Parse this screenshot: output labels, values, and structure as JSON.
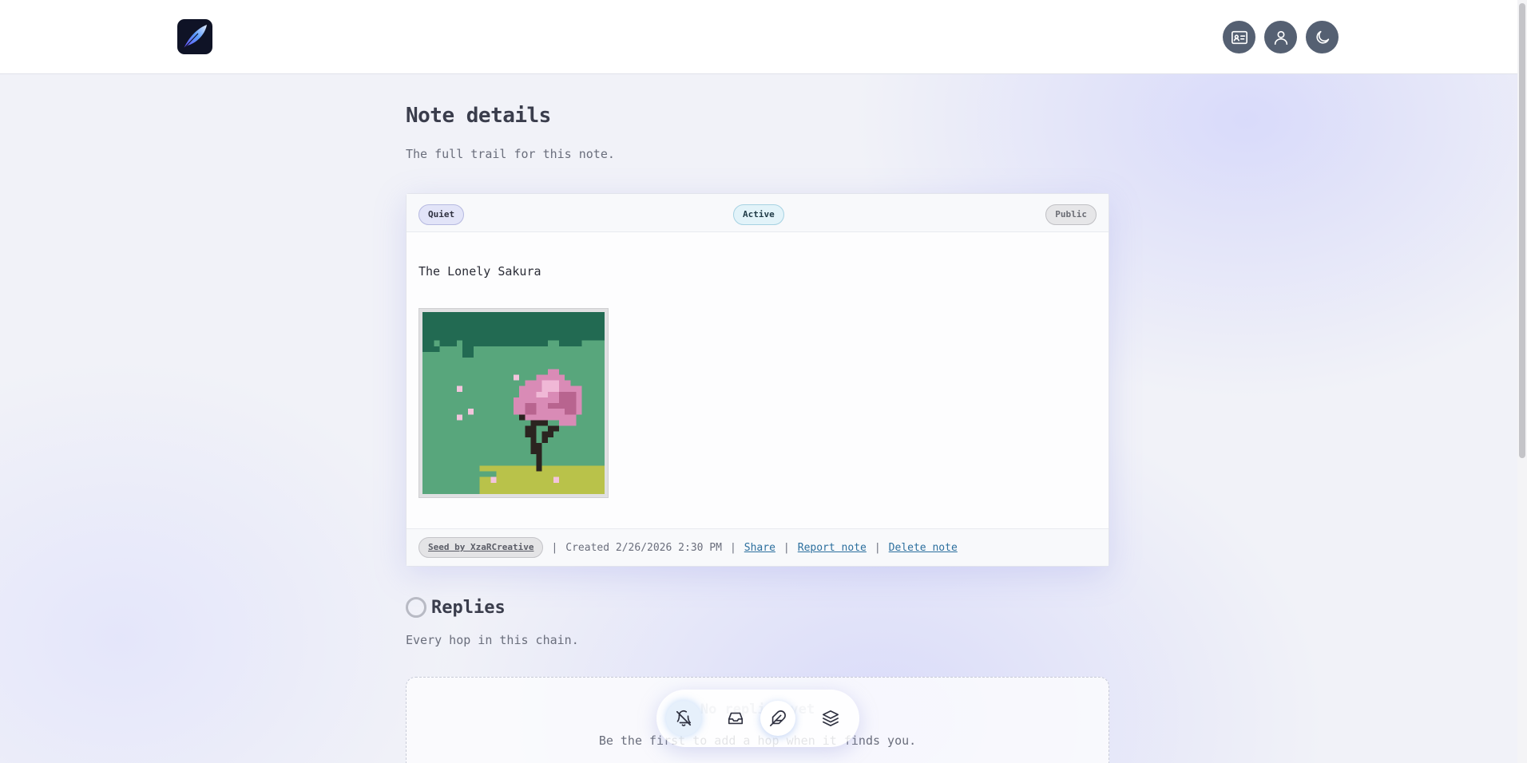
{
  "header": {
    "logo": "feather-logo",
    "icons": [
      "id-card-icon",
      "user-icon",
      "moon-icon"
    ]
  },
  "page": {
    "title": "Note details",
    "subtitle": "The full trail for this note."
  },
  "note": {
    "badges": {
      "quiet": "Quiet",
      "active": "Active",
      "public": "Public"
    },
    "title": "The Lonely Sakura",
    "image": "pixel-art-sakura-tree",
    "footer": {
      "seed_label": "Seed by XzaRCreative",
      "separator": "|",
      "created": "Created 2/26/2026 2:30 PM",
      "share": "Share",
      "report": "Report note",
      "delete": "Delete note"
    }
  },
  "replies": {
    "title": "Replies",
    "subtitle": "Every hop in this chain.",
    "empty_title": "No replies yet",
    "empty_sub": "Be the first to add a hop when it finds you."
  },
  "dock": {
    "icons": [
      "bell-off-icon",
      "inbox-icon",
      "feather-icon",
      "layers-icon"
    ]
  },
  "colors": {
    "accent": "#2c6f9e",
    "icon_bg": "#556072",
    "logo_bg": "#0f1326"
  }
}
